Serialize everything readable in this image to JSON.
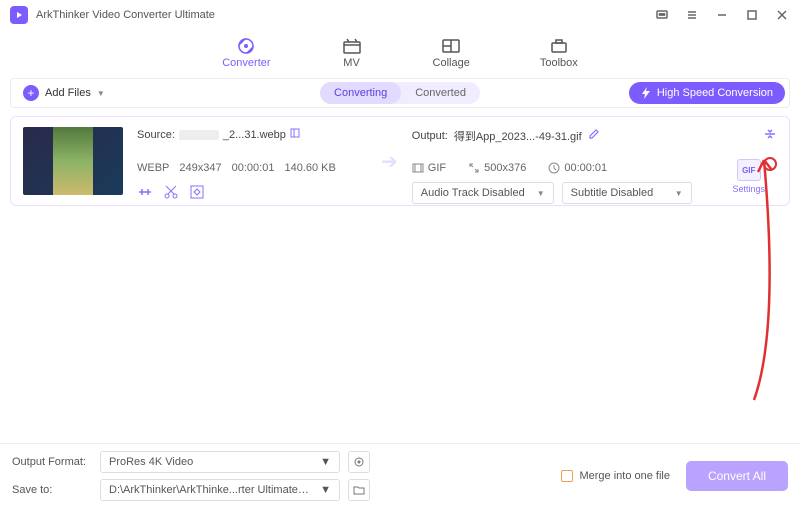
{
  "titlebar": {
    "title": "ArkThinker Video Converter Ultimate"
  },
  "topnav": {
    "converter": "Converter",
    "mv": "MV",
    "collage": "Collage",
    "toolbox": "Toolbox"
  },
  "toolbar": {
    "add_files": "Add Files",
    "converting": "Converting",
    "converted": "Converted",
    "high_speed": "High Speed Conversion"
  },
  "item": {
    "source_label": "Source:",
    "source_name": "_2...31.webp",
    "format": "WEBP",
    "dimensions": "249x347",
    "duration_src": "00:00:01",
    "size": "140.60 KB",
    "output_label": "Output:",
    "output_name": "得到App_2023...-49-31.gif",
    "out_format": "GIF",
    "out_dimensions": "500x376",
    "out_duration": "00:00:01",
    "audio_sel": "Audio Track Disabled",
    "subtitle_sel": "Subtitle Disabled",
    "gif_badge": "GIF",
    "settings": "Settings"
  },
  "bottom": {
    "out_format_label": "Output Format:",
    "out_format_value": "ProRes 4K Video",
    "save_to_label": "Save to:",
    "save_to_value": "D:\\ArkThinker\\ArkThinke...rter Ultimate\\Converted",
    "merge": "Merge into one file",
    "convert_all": "Convert All"
  }
}
